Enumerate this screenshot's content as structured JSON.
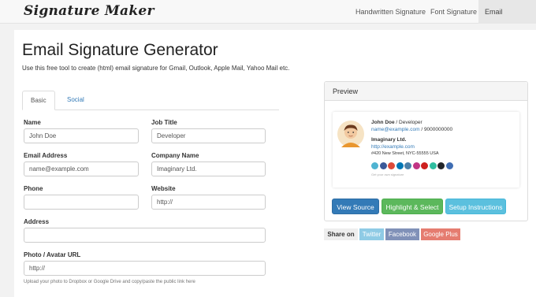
{
  "navbar": {
    "brand": "Signature Maker",
    "links": [
      "Handwritten Signature",
      "Font Signature",
      "Email Signature"
    ],
    "active_link": "Email Signature"
  },
  "page": {
    "title": "Email Signature Generator",
    "subtitle": "Use this free tool to create (html) email signature for Gmail, Outlook, Apple Mail, Yahoo Mail etc."
  },
  "tabs": [
    "Basic",
    "Social"
  ],
  "form": {
    "name_label": "Name",
    "name_placeholder": "John Doe",
    "job_title_label": "Job Title",
    "job_title_placeholder": "Developer",
    "email_label": "Email Address",
    "email_placeholder": "name@example.com",
    "company_label": "Company Name",
    "company_placeholder": "Imaginary Ltd.",
    "phone_label": "Phone",
    "phone_placeholder": "",
    "website_label": "Website",
    "website_placeholder": "http://",
    "address_label": "Address",
    "address_placeholder": "",
    "photo_label": "Photo / Avatar URL",
    "photo_placeholder": "http://",
    "help_text": "Upload your photo to Dropbox or Google Drive and copy/paste the public link here"
  },
  "preview": {
    "heading": "Preview",
    "name": "John Doe",
    "separator": " / ",
    "title": "Developer",
    "email": "name@example.com",
    "phone": "9000000000",
    "company": "Imaginary Ltd.",
    "company_url": "http://example.com",
    "address": "#420 New Street, NYC-55555 USA",
    "footer": "Get your own signature",
    "social_icons": [
      {
        "name": "vimeo-icon",
        "color": "#4fb3d1"
      },
      {
        "name": "facebook-icon",
        "color": "#3b5998"
      },
      {
        "name": "google-plus-icon",
        "color": "#dd4b39"
      },
      {
        "name": "linkedin-icon",
        "color": "#0077b5"
      },
      {
        "name": "github-icon",
        "color": "#4a7fa8"
      },
      {
        "name": "instagram-icon",
        "color": "#c13584"
      },
      {
        "name": "youtube-icon",
        "color": "#cd201f"
      },
      {
        "name": "vine-icon",
        "color": "#2fbea0"
      },
      {
        "name": "tumblr-icon",
        "color": "#22252a"
      },
      {
        "name": "skype-icon",
        "color": "#3f6db3"
      }
    ]
  },
  "buttons": {
    "view_source": "View Source",
    "highlight_select": "Highlight & Select",
    "setup_instructions": "Setup Instructions"
  },
  "share": {
    "label": "Share on",
    "twitter": "Twitter",
    "facebook": "Facebook",
    "google_plus": "Google Plus",
    "twitter_color": "#8fcbe5",
    "facebook_color": "#8091b8",
    "google_plus_color": "#e57c70"
  }
}
